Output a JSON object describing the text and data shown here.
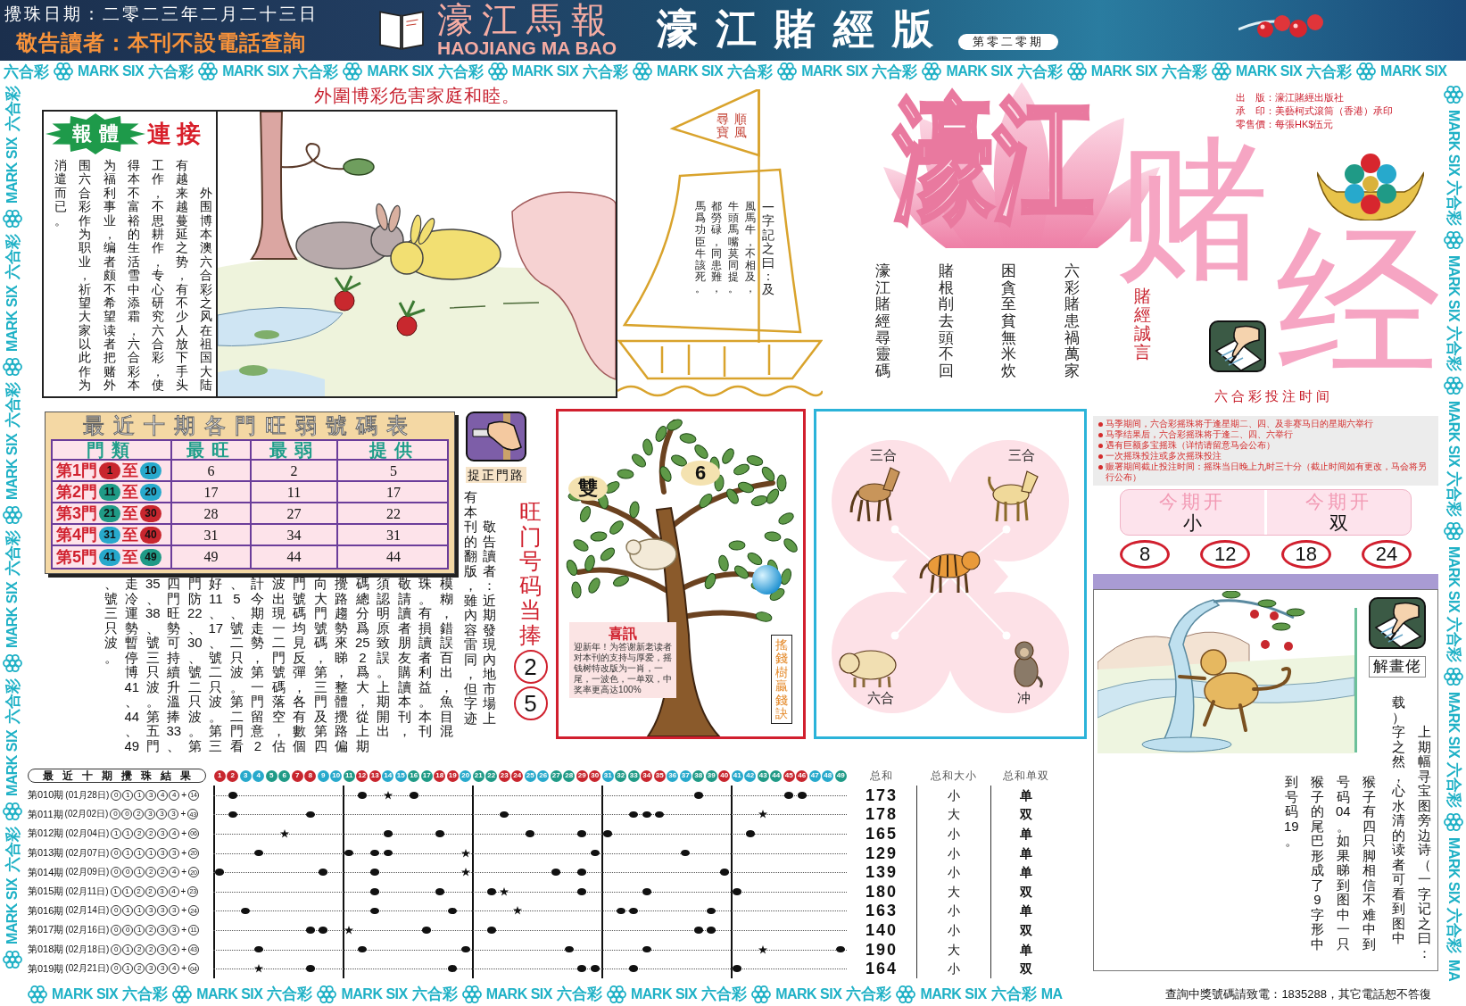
{
  "header": {
    "draw_date": "攪珠日期：二零二三年二月二十三日",
    "notice": "敬告讀者：本刊不設電話查詢",
    "masthead": "濠江馬報",
    "masthead_latin": "HAOJIANG MA BAO",
    "edition": "濠江賭經版",
    "issue": "第零二零期"
  },
  "border": {
    "top": [
      {
        "zh": "六合彩",
        "en": "MARK SIX"
      },
      {
        "zh": "六合彩",
        "en": "MARK SIX"
      },
      {
        "zh": "六合彩",
        "en": "MARK SIX"
      },
      {
        "zh": "六合彩",
        "en": "MARK SIX"
      },
      {
        "zh": "六合彩",
        "en": "MARK SIX"
      },
      {
        "zh": "六合彩",
        "en": "MARK SIX"
      },
      {
        "zh": "六合彩",
        "en": "MARK SIX"
      },
      {
        "zh": "六合彩",
        "en": "MARK SIX"
      },
      {
        "zh": "六合彩",
        "en": "MARK SIX"
      },
      {
        "zh": "六合彩",
        "en": "MARK SIX"
      }
    ],
    "left": [
      {
        "zh": "六合彩",
        "en": "MARK SIX"
      },
      {
        "zh": "六合彩",
        "en": "MARK SIX"
      },
      {
        "zh": "六合彩",
        "en": "MARK SIX"
      },
      {
        "zh": "六合彩",
        "en": "MARK SIX"
      },
      {
        "zh": "六合彩",
        "en": "MARK SIX"
      },
      {
        "zh": "六合彩",
        "en": "MARK SIX"
      }
    ],
    "right": [
      {
        "zh": "六合彩",
        "en": "MARK SIX"
      },
      {
        "zh": "六合彩",
        "en": "MARK SIX"
      },
      {
        "zh": "六合彩",
        "en": "MARK SIX"
      },
      {
        "zh": "六合彩",
        "en": "MARK SIX"
      },
      {
        "zh": "六合彩",
        "en": "MARK SIX"
      },
      {
        "zh": "六合彩",
        "en": "MARK SIX"
      }
    ],
    "right_tail": "MA",
    "bottom": [
      {
        "zh": "六合彩",
        "en": "MARK SIX"
      },
      {
        "zh": "六合彩",
        "en": "MARK SIX"
      },
      {
        "zh": "六合彩",
        "en": "MARK SIX"
      },
      {
        "zh": "六合彩",
        "en": "MARK SIX"
      },
      {
        "zh": "六合彩",
        "en": "MARK SIX"
      },
      {
        "zh": "六合彩",
        "en": "MARK SIX"
      },
      {
        "zh": "六合彩",
        "en": "MARK SIX"
      }
    ],
    "bottom_tail": "MA"
  },
  "article": {
    "headline": "外圍博彩危害家庭和睦。",
    "badge": "報體",
    "badge_tail": "連接",
    "columns": [
      "消遣而已。",
      "围六合彩作为职业，祈望大家以此作为",
      "为福利事业，编者颇不希望读者把赌外",
      "得本不富裕的生活雪中添霜，六合彩本",
      "工作，不思耕作，专心研究六合彩，使",
      "有越来越蔓延之势，有不少人放下手头",
      "外围博本澳六合彩之风在祖国大陆"
    ]
  },
  "sail": {
    "flag": [
      "尋寶",
      "順風"
    ],
    "columns": [
      "馬爲功臣牛該死。",
      "都勞碌，同患難，",
      "牛頭馬嘴莫同提。",
      "風馬牛，不相及，",
      "一字記之曰：及"
    ]
  },
  "logo": {
    "top": "濠江",
    "left": "赌",
    "right": "经"
  },
  "publisher": [
    "出　版：濠江賭經出版社",
    "承　印：美藝柯式滾筒（香港）承印",
    "零售價：每張HK$伍元"
  ],
  "poem": {
    "title": "賭經誠言",
    "columns": [
      "濠江賭經尋靈碼",
      "賭根削去頭不回",
      "困貪至貧無米炊",
      "六彩賭患禍萬家"
    ]
  },
  "betting_time": {
    "title": "六合彩投注时间",
    "rules": [
      "马季期间，六合彩摇珠将于逢星期二、四、及非赛马日的星期六举行",
      "马季结果后，六合彩摇珠将于逢二、四、六举行",
      "遇有巨额多宝摇珠（详情请留意马会公布）",
      "一次摇珠投注或多次摇珠投注",
      "赈署期间截止投注时间：摇珠当日晚上九时三十分（截止时间如有更改，马会将另行公布）"
    ]
  },
  "door_table": {
    "title": "最近十期各門旺弱號碼表",
    "columns": [
      "門類",
      "最旺",
      "最弱",
      "提供"
    ],
    "rows": [
      {
        "door": "第1門",
        "from": {
          "number": "1",
          "color": "#c8262e"
        },
        "to_word": "至",
        "to": {
          "number": "10",
          "color": "#27a9cc"
        },
        "hot": "6",
        "cold": "2",
        "pick": "5"
      },
      {
        "door": "第2門",
        "from": {
          "number": "11",
          "color": "#1f9a86"
        },
        "to_word": "至",
        "to": {
          "number": "20",
          "color": "#27a9cc"
        },
        "hot": "17",
        "cold": "11",
        "pick": "17"
      },
      {
        "door": "第3門",
        "from": {
          "number": "21",
          "color": "#1f9a86"
        },
        "to_word": "至",
        "to": {
          "number": "30",
          "color": "#c8262e"
        },
        "hot": "28",
        "cold": "27",
        "pick": "22"
      },
      {
        "door": "第4門",
        "from": {
          "number": "31",
          "color": "#27a9cc"
        },
        "to_word": "至",
        "to": {
          "number": "40",
          "color": "#c8262e"
        },
        "hot": "31",
        "cold": "34",
        "pick": "31"
      },
      {
        "door": "第5門",
        "from": {
          "number": "41",
          "color": "#27a9cc"
        },
        "to_word": "至",
        "to": {
          "number": "49",
          "color": "#1f9a86"
        },
        "hot": "49",
        "cold": "44",
        "pick": "44"
      }
    ]
  },
  "door_tip": {
    "label": "捉正門路"
  },
  "notice": {
    "columns": [
      "、號三只波。",
      "走冷運勢暫停博41、44、49",
      "35、38、號三只波。第五門",
      "四門旺勢可持續升溫捧33、",
      "門防22、30、號二只波。第",
      "好11、17、號二只波。第三",
      "、5、號二只波。第二門看",
      "計今期走勢，第一門留意2",
      "波出現一二門號碼落空，估",
      "門號碼均見反彈，各有數個",
      "向大門號碼，第三門及第四",
      "攪路趨勢來睇，整體攪路偏",
      "碼總分爲252爲大，從上期",
      "須認明原致誤。上期開出",
      "敬請讀者朋友購讀本刊，",
      "珠。有損讀者利益。本刊",
      "模糊，錯誤百出，魚目混",
      "有本刊的翻版，雖內容雷同，但字迹",
      "敬告讀者：近期發現內地市場上"
    ]
  },
  "hot": {
    "title": "旺门号码当捧",
    "numbers": [
      "2",
      "5"
    ]
  },
  "money_tree": {
    "pair": "雙",
    "number": "6",
    "news_title": "喜訊",
    "news_text": "迎新年！为答谢新老读者对本刊的支持与厚爱，摇钱树特改版为一肖，一尾，一波色，一单双，中奖率更高达100%",
    "side_title": "搖錢樹贏錢訣"
  },
  "zodiac": {
    "labels": [
      "三合",
      "三合",
      "六合",
      "冲"
    ]
  },
  "this_draw": [
    {
      "heading": "今期开",
      "value": "小"
    },
    {
      "heading": "今期开",
      "value": "双"
    }
  ],
  "lucky_numbers": [
    "8",
    "12",
    "18",
    "24"
  ],
  "riddle": {
    "label": "解畫佬",
    "columns": [
      "到号码19。",
      "猴子的尾巴形成了9字形中",
      "号码04。如果睇到图中一只",
      "猴子有四只脚相信不难中到",
      "载）字之然，心水清的读者可看到图中",
      "上期幅寻宝图旁边诗（一字记之曰："
    ]
  },
  "results": {
    "title": "最近十期攪珠結果",
    "balls": [
      {
        "number": "1",
        "color": "#c8262e"
      },
      {
        "number": "2",
        "color": "#c8262e"
      },
      {
        "number": "3",
        "color": "#27a9cc"
      },
      {
        "number": "4",
        "color": "#27a9cc"
      },
      {
        "number": "5",
        "color": "#1f9a86"
      },
      {
        "number": "6",
        "color": "#1f9a86"
      },
      {
        "number": "7",
        "color": "#c8262e"
      },
      {
        "number": "8",
        "color": "#c8262e"
      },
      {
        "number": "9",
        "color": "#27a9cc"
      },
      {
        "number": "10",
        "color": "#27a9cc"
      },
      {
        "number": "11",
        "color": "#1f9a86"
      },
      {
        "number": "12",
        "color": "#c8262e"
      },
      {
        "number": "13",
        "color": "#c8262e"
      },
      {
        "number": "14",
        "color": "#27a9cc"
      },
      {
        "number": "15",
        "color": "#27a9cc"
      },
      {
        "number": "16",
        "color": "#1f9a86"
      },
      {
        "number": "17",
        "color": "#1f9a86"
      },
      {
        "number": "18",
        "color": "#c8262e"
      },
      {
        "number": "19",
        "color": "#c8262e"
      },
      {
        "number": "20",
        "color": "#27a9cc"
      },
      {
        "number": "21",
        "color": "#1f9a86"
      },
      {
        "number": "22",
        "color": "#1f9a86"
      },
      {
        "number": "23",
        "color": "#c8262e"
      },
      {
        "number": "24",
        "color": "#c8262e"
      },
      {
        "number": "25",
        "color": "#27a9cc"
      },
      {
        "number": "26",
        "color": "#27a9cc"
      },
      {
        "number": "27",
        "color": "#1f9a86"
      },
      {
        "number": "28",
        "color": "#1f9a86"
      },
      {
        "number": "29",
        "color": "#c8262e"
      },
      {
        "number": "30",
        "color": "#c8262e"
      },
      {
        "number": "31",
        "color": "#27a9cc"
      },
      {
        "number": "32",
        "color": "#1f9a86"
      },
      {
        "number": "33",
        "color": "#1f9a86"
      },
      {
        "number": "34",
        "color": "#c8262e"
      },
      {
        "number": "35",
        "color": "#c8262e"
      },
      {
        "number": "36",
        "color": "#27a9cc"
      },
      {
        "number": "37",
        "color": "#27a9cc"
      },
      {
        "number": "38",
        "color": "#1f9a86"
      },
      {
        "number": "39",
        "color": "#1f9a86"
      },
      {
        "number": "40",
        "color": "#c8262e"
      },
      {
        "number": "41",
        "color": "#27a9cc"
      },
      {
        "number": "42",
        "color": "#27a9cc"
      },
      {
        "number": "43",
        "color": "#1f9a86"
      },
      {
        "number": "44",
        "color": "#1f9a86"
      },
      {
        "number": "45",
        "color": "#c8262e"
      },
      {
        "number": "46",
        "color": "#c8262e"
      },
      {
        "number": "47",
        "color": "#27a9cc"
      },
      {
        "number": "48",
        "color": "#27a9cc"
      },
      {
        "number": "49",
        "color": "#1f9a86"
      }
    ],
    "columns": [
      "总和",
      "总和大小",
      "总和单双"
    ],
    "rows": [
      {
        "issue": "第010期",
        "date": "(01月28日)",
        "heads": [
          "0",
          "1",
          "1",
          "3",
          "4",
          "4"
        ],
        "joiner": "+",
        "special": "14",
        "cells": [
          {
            "kind": "none"
          },
          {
            "kind": "dot"
          },
          {
            "kind": "none"
          },
          {
            "kind": "none"
          },
          {
            "kind": "none"
          },
          {
            "kind": "none"
          },
          {
            "kind": "none"
          },
          {
            "kind": "none"
          },
          {
            "kind": "none"
          },
          {
            "kind": "none"
          },
          {
            "kind": "none"
          },
          {
            "kind": "dot"
          },
          {
            "kind": "none"
          },
          {
            "kind": "star"
          },
          {
            "kind": "none"
          },
          {
            "kind": "dot"
          },
          {
            "kind": "none"
          },
          {
            "kind": "none"
          },
          {
            "kind": "none"
          },
          {
            "kind": "none"
          },
          {
            "kind": "none"
          },
          {
            "kind": "none"
          },
          {
            "kind": "none"
          },
          {
            "kind": "none"
          },
          {
            "kind": "none"
          },
          {
            "kind": "none"
          },
          {
            "kind": "none"
          },
          {
            "kind": "none"
          },
          {
            "kind": "none"
          },
          {
            "kind": "none"
          },
          {
            "kind": "none"
          },
          {
            "kind": "none"
          },
          {
            "kind": "none"
          },
          {
            "kind": "none"
          },
          {
            "kind": "none"
          },
          {
            "kind": "none"
          },
          {
            "kind": "none"
          },
          {
            "kind": "dot"
          },
          {
            "kind": "none"
          },
          {
            "kind": "none"
          },
          {
            "kind": "none"
          },
          {
            "kind": "none"
          },
          {
            "kind": "none"
          },
          {
            "kind": "none"
          },
          {
            "kind": "dot"
          },
          {
            "kind": "dot"
          },
          {
            "kind": "none"
          },
          {
            "kind": "none"
          },
          {
            "kind": "none"
          }
        ],
        "sum": "173",
        "size": "小",
        "parity": "单"
      },
      {
        "issue": "第011期",
        "date": "(02月02日)",
        "heads": [
          "0",
          "0",
          "2",
          "3",
          "3",
          "3"
        ],
        "joiner": "+",
        "special": "43",
        "cells": [
          {
            "kind": "none"
          },
          {
            "kind": "dot"
          },
          {
            "kind": "none"
          },
          {
            "kind": "none"
          },
          {
            "kind": "none"
          },
          {
            "kind": "none"
          },
          {
            "kind": "none"
          },
          {
            "kind": "dot"
          },
          {
            "kind": "none"
          },
          {
            "kind": "none"
          },
          {
            "kind": "none"
          },
          {
            "kind": "none"
          },
          {
            "kind": "none"
          },
          {
            "kind": "none"
          },
          {
            "kind": "none"
          },
          {
            "kind": "none"
          },
          {
            "kind": "none"
          },
          {
            "kind": "none"
          },
          {
            "kind": "none"
          },
          {
            "kind": "none"
          },
          {
            "kind": "none"
          },
          {
            "kind": "none"
          },
          {
            "kind": "dot"
          },
          {
            "kind": "none"
          },
          {
            "kind": "none"
          },
          {
            "kind": "none"
          },
          {
            "kind": "none"
          },
          {
            "kind": "none"
          },
          {
            "kind": "none"
          },
          {
            "kind": "none"
          },
          {
            "kind": "none"
          },
          {
            "kind": "none"
          },
          {
            "kind": "dot"
          },
          {
            "kind": "dot"
          },
          {
            "kind": "dot"
          },
          {
            "kind": "none"
          },
          {
            "kind": "none"
          },
          {
            "kind": "none"
          },
          {
            "kind": "none"
          },
          {
            "kind": "none"
          },
          {
            "kind": "none"
          },
          {
            "kind": "none"
          },
          {
            "kind": "star"
          },
          {
            "kind": "none"
          },
          {
            "kind": "none"
          },
          {
            "kind": "none"
          },
          {
            "kind": "none"
          },
          {
            "kind": "none"
          },
          {
            "kind": "none"
          }
        ],
        "sum": "178",
        "size": "大",
        "parity": "双"
      },
      {
        "issue": "第012期",
        "date": "(02月04日)",
        "heads": [
          "1",
          "1",
          "2",
          "2",
          "3",
          "4"
        ],
        "joiner": "+",
        "special": "06",
        "cells": [
          {
            "kind": "none"
          },
          {
            "kind": "none"
          },
          {
            "kind": "none"
          },
          {
            "kind": "none"
          },
          {
            "kind": "none"
          },
          {
            "kind": "star"
          },
          {
            "kind": "none"
          },
          {
            "kind": "none"
          },
          {
            "kind": "none"
          },
          {
            "kind": "none"
          },
          {
            "kind": "none"
          },
          {
            "kind": "none"
          },
          {
            "kind": "none"
          },
          {
            "kind": "dot"
          },
          {
            "kind": "none"
          },
          {
            "kind": "none"
          },
          {
            "kind": "none"
          },
          {
            "kind": "dot"
          },
          {
            "kind": "none"
          },
          {
            "kind": "none"
          },
          {
            "kind": "none"
          },
          {
            "kind": "none"
          },
          {
            "kind": "none"
          },
          {
            "kind": "none"
          },
          {
            "kind": "dot"
          },
          {
            "kind": "none"
          },
          {
            "kind": "none"
          },
          {
            "kind": "none"
          },
          {
            "kind": "dot"
          },
          {
            "kind": "none"
          },
          {
            "kind": "dot"
          },
          {
            "kind": "none"
          },
          {
            "kind": "none"
          },
          {
            "kind": "none"
          },
          {
            "kind": "none"
          },
          {
            "kind": "none"
          },
          {
            "kind": "none"
          },
          {
            "kind": "none"
          },
          {
            "kind": "none"
          },
          {
            "kind": "none"
          },
          {
            "kind": "none"
          },
          {
            "kind": "dot"
          },
          {
            "kind": "none"
          },
          {
            "kind": "none"
          },
          {
            "kind": "none"
          },
          {
            "kind": "none"
          },
          {
            "kind": "none"
          },
          {
            "kind": "none"
          },
          {
            "kind": "none"
          }
        ],
        "sum": "165",
        "size": "小",
        "parity": "单"
      },
      {
        "issue": "第013期",
        "date": "(02月07日)",
        "heads": [
          "0",
          "1",
          "1",
          "1",
          "3",
          "3"
        ],
        "joiner": "+",
        "special": "20",
        "cells": [
          {
            "kind": "none"
          },
          {
            "kind": "none"
          },
          {
            "kind": "none"
          },
          {
            "kind": "dot"
          },
          {
            "kind": "none"
          },
          {
            "kind": "none"
          },
          {
            "kind": "none"
          },
          {
            "kind": "none"
          },
          {
            "kind": "none"
          },
          {
            "kind": "none"
          },
          {
            "kind": "dot"
          },
          {
            "kind": "none"
          },
          {
            "kind": "dot"
          },
          {
            "kind": "dot"
          },
          {
            "kind": "none"
          },
          {
            "kind": "none"
          },
          {
            "kind": "none"
          },
          {
            "kind": "none"
          },
          {
            "kind": "none"
          },
          {
            "kind": "star"
          },
          {
            "kind": "none"
          },
          {
            "kind": "none"
          },
          {
            "kind": "none"
          },
          {
            "kind": "none"
          },
          {
            "kind": "none"
          },
          {
            "kind": "none"
          },
          {
            "kind": "none"
          },
          {
            "kind": "none"
          },
          {
            "kind": "none"
          },
          {
            "kind": "dot"
          },
          {
            "kind": "none"
          },
          {
            "kind": "none"
          },
          {
            "kind": "none"
          },
          {
            "kind": "none"
          },
          {
            "kind": "none"
          },
          {
            "kind": "none"
          },
          {
            "kind": "dot"
          },
          {
            "kind": "none"
          },
          {
            "kind": "none"
          },
          {
            "kind": "none"
          },
          {
            "kind": "none"
          },
          {
            "kind": "none"
          },
          {
            "kind": "none"
          },
          {
            "kind": "none"
          },
          {
            "kind": "none"
          },
          {
            "kind": "none"
          },
          {
            "kind": "none"
          },
          {
            "kind": "none"
          },
          {
            "kind": "none"
          }
        ],
        "sum": "129",
        "size": "小",
        "parity": "单"
      },
      {
        "issue": "第014期",
        "date": "(02月09日)",
        "heads": [
          "0",
          "0",
          "1",
          "2",
          "2",
          "4"
        ],
        "joiner": "+",
        "special": "20",
        "cells": [
          {
            "kind": "dot"
          },
          {
            "kind": "none"
          },
          {
            "kind": "none"
          },
          {
            "kind": "none"
          },
          {
            "kind": "none"
          },
          {
            "kind": "none"
          },
          {
            "kind": "none"
          },
          {
            "kind": "none"
          },
          {
            "kind": "dot"
          },
          {
            "kind": "none"
          },
          {
            "kind": "none"
          },
          {
            "kind": "none"
          },
          {
            "kind": "dot"
          },
          {
            "kind": "none"
          },
          {
            "kind": "none"
          },
          {
            "kind": "none"
          },
          {
            "kind": "none"
          },
          {
            "kind": "none"
          },
          {
            "kind": "none"
          },
          {
            "kind": "star"
          },
          {
            "kind": "none"
          },
          {
            "kind": "none"
          },
          {
            "kind": "none"
          },
          {
            "kind": "none"
          },
          {
            "kind": "none"
          },
          {
            "kind": "none"
          },
          {
            "kind": "dot"
          },
          {
            "kind": "none"
          },
          {
            "kind": "dot"
          },
          {
            "kind": "none"
          },
          {
            "kind": "none"
          },
          {
            "kind": "none"
          },
          {
            "kind": "none"
          },
          {
            "kind": "none"
          },
          {
            "kind": "none"
          },
          {
            "kind": "none"
          },
          {
            "kind": "none"
          },
          {
            "kind": "none"
          },
          {
            "kind": "none"
          },
          {
            "kind": "dot"
          },
          {
            "kind": "none"
          },
          {
            "kind": "none"
          },
          {
            "kind": "none"
          },
          {
            "kind": "none"
          },
          {
            "kind": "none"
          },
          {
            "kind": "none"
          },
          {
            "kind": "none"
          },
          {
            "kind": "none"
          },
          {
            "kind": "none"
          }
        ],
        "sum": "139",
        "size": "小",
        "parity": "单"
      },
      {
        "issue": "第015期",
        "date": "(02月11日)",
        "heads": [
          "1",
          "1",
          "2",
          "2",
          "3",
          "4"
        ],
        "joiner": "+",
        "special": "23",
        "cells": [
          {
            "kind": "none"
          },
          {
            "kind": "none"
          },
          {
            "kind": "none"
          },
          {
            "kind": "none"
          },
          {
            "kind": "none"
          },
          {
            "kind": "none"
          },
          {
            "kind": "none"
          },
          {
            "kind": "none"
          },
          {
            "kind": "none"
          },
          {
            "kind": "none"
          },
          {
            "kind": "none"
          },
          {
            "kind": "none"
          },
          {
            "kind": "dot"
          },
          {
            "kind": "none"
          },
          {
            "kind": "none"
          },
          {
            "kind": "none"
          },
          {
            "kind": "none"
          },
          {
            "kind": "dot"
          },
          {
            "kind": "none"
          },
          {
            "kind": "none"
          },
          {
            "kind": "none"
          },
          {
            "kind": "dot"
          },
          {
            "kind": "star"
          },
          {
            "kind": "none"
          },
          {
            "kind": "none"
          },
          {
            "kind": "none"
          },
          {
            "kind": "none"
          },
          {
            "kind": "none"
          },
          {
            "kind": "dot"
          },
          {
            "kind": "none"
          },
          {
            "kind": "none"
          },
          {
            "kind": "none"
          },
          {
            "kind": "none"
          },
          {
            "kind": "dot"
          },
          {
            "kind": "none"
          },
          {
            "kind": "none"
          },
          {
            "kind": "none"
          },
          {
            "kind": "none"
          },
          {
            "kind": "none"
          },
          {
            "kind": "none"
          },
          {
            "kind": "dot"
          },
          {
            "kind": "none"
          },
          {
            "kind": "none"
          },
          {
            "kind": "none"
          },
          {
            "kind": "none"
          },
          {
            "kind": "none"
          },
          {
            "kind": "none"
          },
          {
            "kind": "none"
          },
          {
            "kind": "none"
          }
        ],
        "sum": "180",
        "size": "大",
        "parity": "双"
      },
      {
        "issue": "第016期",
        "date": "(02月14日)",
        "heads": [
          "0",
          "1",
          "1",
          "3",
          "3",
          "3"
        ],
        "joiner": "+",
        "special": "24",
        "cells": [
          {
            "kind": "none"
          },
          {
            "kind": "none"
          },
          {
            "kind": "dot"
          },
          {
            "kind": "none"
          },
          {
            "kind": "none"
          },
          {
            "kind": "none"
          },
          {
            "kind": "none"
          },
          {
            "kind": "none"
          },
          {
            "kind": "none"
          },
          {
            "kind": "none"
          },
          {
            "kind": "none"
          },
          {
            "kind": "none"
          },
          {
            "kind": "dot"
          },
          {
            "kind": "none"
          },
          {
            "kind": "none"
          },
          {
            "kind": "none"
          },
          {
            "kind": "none"
          },
          {
            "kind": "none"
          },
          {
            "kind": "dot"
          },
          {
            "kind": "none"
          },
          {
            "kind": "none"
          },
          {
            "kind": "none"
          },
          {
            "kind": "none"
          },
          {
            "kind": "star"
          },
          {
            "kind": "none"
          },
          {
            "kind": "none"
          },
          {
            "kind": "none"
          },
          {
            "kind": "none"
          },
          {
            "kind": "none"
          },
          {
            "kind": "none"
          },
          {
            "kind": "none"
          },
          {
            "kind": "dot"
          },
          {
            "kind": "dot"
          },
          {
            "kind": "none"
          },
          {
            "kind": "none"
          },
          {
            "kind": "none"
          },
          {
            "kind": "none"
          },
          {
            "kind": "none"
          },
          {
            "kind": "dot"
          },
          {
            "kind": "none"
          },
          {
            "kind": "none"
          },
          {
            "kind": "none"
          },
          {
            "kind": "none"
          },
          {
            "kind": "none"
          },
          {
            "kind": "none"
          },
          {
            "kind": "none"
          },
          {
            "kind": "none"
          },
          {
            "kind": "none"
          },
          {
            "kind": "none"
          }
        ],
        "sum": "163",
        "size": "小",
        "parity": "单"
      },
      {
        "issue": "第017期",
        "date": "(02月16日)",
        "heads": [
          "0",
          "0",
          "1",
          "2",
          "3",
          "3"
        ],
        "joiner": "+",
        "special": "11",
        "cells": [
          {
            "kind": "none"
          },
          {
            "kind": "none"
          },
          {
            "kind": "none"
          },
          {
            "kind": "none"
          },
          {
            "kind": "none"
          },
          {
            "kind": "none"
          },
          {
            "kind": "none"
          },
          {
            "kind": "dot"
          },
          {
            "kind": "dot"
          },
          {
            "kind": "none"
          },
          {
            "kind": "star"
          },
          {
            "kind": "none"
          },
          {
            "kind": "none"
          },
          {
            "kind": "none"
          },
          {
            "kind": "none"
          },
          {
            "kind": "none"
          },
          {
            "kind": "dot"
          },
          {
            "kind": "none"
          },
          {
            "kind": "none"
          },
          {
            "kind": "none"
          },
          {
            "kind": "none"
          },
          {
            "kind": "dot"
          },
          {
            "kind": "none"
          },
          {
            "kind": "none"
          },
          {
            "kind": "none"
          },
          {
            "kind": "none"
          },
          {
            "kind": "none"
          },
          {
            "kind": "none"
          },
          {
            "kind": "none"
          },
          {
            "kind": "none"
          },
          {
            "kind": "none"
          },
          {
            "kind": "none"
          },
          {
            "kind": "none"
          },
          {
            "kind": "none"
          },
          {
            "kind": "none"
          },
          {
            "kind": "none"
          },
          {
            "kind": "none"
          },
          {
            "kind": "dot"
          },
          {
            "kind": "dot"
          },
          {
            "kind": "none"
          },
          {
            "kind": "none"
          },
          {
            "kind": "none"
          },
          {
            "kind": "none"
          },
          {
            "kind": "none"
          },
          {
            "kind": "none"
          },
          {
            "kind": "none"
          },
          {
            "kind": "none"
          },
          {
            "kind": "none"
          },
          {
            "kind": "none"
          }
        ],
        "sum": "140",
        "size": "小",
        "parity": "双"
      },
      {
        "issue": "第018期",
        "date": "(02月18日)",
        "heads": [
          "0",
          "1",
          "2",
          "2",
          "3",
          "4"
        ],
        "joiner": "+",
        "special": "43",
        "cells": [
          {
            "kind": "none"
          },
          {
            "kind": "none"
          },
          {
            "kind": "none"
          },
          {
            "kind": "dot"
          },
          {
            "kind": "none"
          },
          {
            "kind": "none"
          },
          {
            "kind": "none"
          },
          {
            "kind": "none"
          },
          {
            "kind": "none"
          },
          {
            "kind": "none"
          },
          {
            "kind": "none"
          },
          {
            "kind": "dot"
          },
          {
            "kind": "none"
          },
          {
            "kind": "none"
          },
          {
            "kind": "none"
          },
          {
            "kind": "none"
          },
          {
            "kind": "none"
          },
          {
            "kind": "none"
          },
          {
            "kind": "none"
          },
          {
            "kind": "dot"
          },
          {
            "kind": "none"
          },
          {
            "kind": "none"
          },
          {
            "kind": "none"
          },
          {
            "kind": "none"
          },
          {
            "kind": "none"
          },
          {
            "kind": "none"
          },
          {
            "kind": "none"
          },
          {
            "kind": "dot"
          },
          {
            "kind": "none"
          },
          {
            "kind": "none"
          },
          {
            "kind": "none"
          },
          {
            "kind": "none"
          },
          {
            "kind": "none"
          },
          {
            "kind": "dot"
          },
          {
            "kind": "none"
          },
          {
            "kind": "none"
          },
          {
            "kind": "none"
          },
          {
            "kind": "none"
          },
          {
            "kind": "none"
          },
          {
            "kind": "none"
          },
          {
            "kind": "none"
          },
          {
            "kind": "none"
          },
          {
            "kind": "star"
          },
          {
            "kind": "none"
          },
          {
            "kind": "none"
          },
          {
            "kind": "none"
          },
          {
            "kind": "none"
          },
          {
            "kind": "none"
          },
          {
            "kind": "dot"
          }
        ],
        "sum": "190",
        "size": "大",
        "parity": "单"
      },
      {
        "issue": "第019期",
        "date": "(02月21日)",
        "heads": [
          "0",
          "1",
          "2",
          "3",
          "3",
          "4"
        ],
        "joiner": "+",
        "special": "04",
        "cells": [
          {
            "kind": "none"
          },
          {
            "kind": "none"
          },
          {
            "kind": "none"
          },
          {
            "kind": "star"
          },
          {
            "kind": "none"
          },
          {
            "kind": "none"
          },
          {
            "kind": "none"
          },
          {
            "kind": "dot"
          },
          {
            "kind": "none"
          },
          {
            "kind": "none"
          },
          {
            "kind": "none"
          },
          {
            "kind": "none"
          },
          {
            "kind": "none"
          },
          {
            "kind": "none"
          },
          {
            "kind": "none"
          },
          {
            "kind": "none"
          },
          {
            "kind": "none"
          },
          {
            "kind": "none"
          },
          {
            "kind": "dot"
          },
          {
            "kind": "none"
          },
          {
            "kind": "none"
          },
          {
            "kind": "none"
          },
          {
            "kind": "none"
          },
          {
            "kind": "none"
          },
          {
            "kind": "none"
          },
          {
            "kind": "none"
          },
          {
            "kind": "none"
          },
          {
            "kind": "none"
          },
          {
            "kind": "dot"
          },
          {
            "kind": "dot"
          },
          {
            "kind": "none"
          },
          {
            "kind": "none"
          },
          {
            "kind": "dot"
          },
          {
            "kind": "none"
          },
          {
            "kind": "none"
          },
          {
            "kind": "none"
          },
          {
            "kind": "none"
          },
          {
            "kind": "none"
          },
          {
            "kind": "none"
          },
          {
            "kind": "none"
          },
          {
            "kind": "dot"
          },
          {
            "kind": "none"
          },
          {
            "kind": "none"
          },
          {
            "kind": "none"
          },
          {
            "kind": "none"
          },
          {
            "kind": "none"
          },
          {
            "kind": "none"
          },
          {
            "kind": "none"
          },
          {
            "kind": "none"
          }
        ],
        "sum": "164",
        "size": "小",
        "parity": "双"
      }
    ]
  },
  "footer_notice": "查詢中獎號碼請致電：1835288，其它電話恕不答復"
}
